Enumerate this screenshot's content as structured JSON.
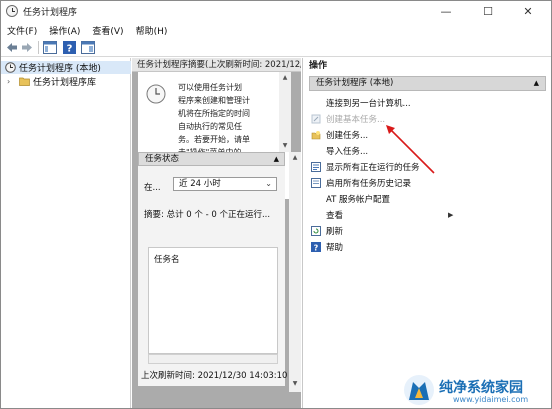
{
  "window": {
    "title": "任务计划程序",
    "minimize_glyph": "—",
    "maximize_glyph": "☐",
    "close_glyph": "✕"
  },
  "menu": [
    "文件(F)",
    "操作(A)",
    "查看(V)",
    "帮助(H)"
  ],
  "toolbar": {
    "icons": [
      "back-arrow-icon",
      "forward-arrow-icon",
      "show-hide-tree-icon",
      "help-icon",
      "view-panel-icon"
    ]
  },
  "tree": {
    "items": [
      {
        "label": "任务计划程序 (本地)",
        "icon": "clock-icon",
        "selected": true
      },
      {
        "label": "任务计划程序库",
        "icon": "folder-icon",
        "expander": "›"
      }
    ]
  },
  "middle": {
    "header": "任务计划程序摘要(上次刷新时间: 2021/12/",
    "description_lines": [
      "可以使用任务计划",
      "程序来创建和管理计",
      "机将在所指定的时间",
      "自动执行的常见任",
      "务。若要开始，请单",
      "击\"操作\"菜单中的"
    ],
    "status_header": "任务状态",
    "status_collapse": "▲",
    "in_label": "在...",
    "period": "近 24 小时",
    "combo_chevron": "⌄",
    "summary": "摘要: 总计 0 个 - 0 个正在运行...",
    "task_name_header": "任务名",
    "last_refresh": "上次刷新时间: 2021/12/30 14:03:10"
  },
  "actions": {
    "header": "操作",
    "group": "任务计划程序 (本地)",
    "group_collapse": "▲",
    "items": [
      {
        "label": "连接到另一台计算机...",
        "icon": "",
        "disabled": false
      },
      {
        "label": "创建基本任务...",
        "icon": "wizard-icon",
        "disabled": true
      },
      {
        "label": "创建任务...",
        "icon": "create-task-icon",
        "disabled": false
      },
      {
        "label": "导入任务...",
        "icon": "",
        "disabled": false
      },
      {
        "label": "显示所有正在运行的任务",
        "icon": "running-tasks-icon",
        "disabled": false
      },
      {
        "label": "启用所有任务历史记录",
        "icon": "history-icon",
        "disabled": false
      },
      {
        "label": "AT 服务帐户配置",
        "icon": "",
        "disabled": false
      },
      {
        "label": "查看",
        "icon": "",
        "disabled": false,
        "submenu": "▶"
      },
      {
        "label": "刷新",
        "icon": "refresh-icon",
        "disabled": false
      },
      {
        "label": "帮助",
        "icon": "help-icon",
        "disabled": false
      }
    ]
  },
  "annotation": {
    "arrow_color": "#d91a1a"
  },
  "watermark": {
    "title": "纯净系统家园",
    "url": "www.yidaimei.com"
  },
  "colors": {
    "selection": "#d9e8f8",
    "pane_gray": "#ababab",
    "group_header": "#d7d7d7",
    "disabled_text": "#a8a8a8",
    "watermark_blue": "#1b6fb5"
  }
}
